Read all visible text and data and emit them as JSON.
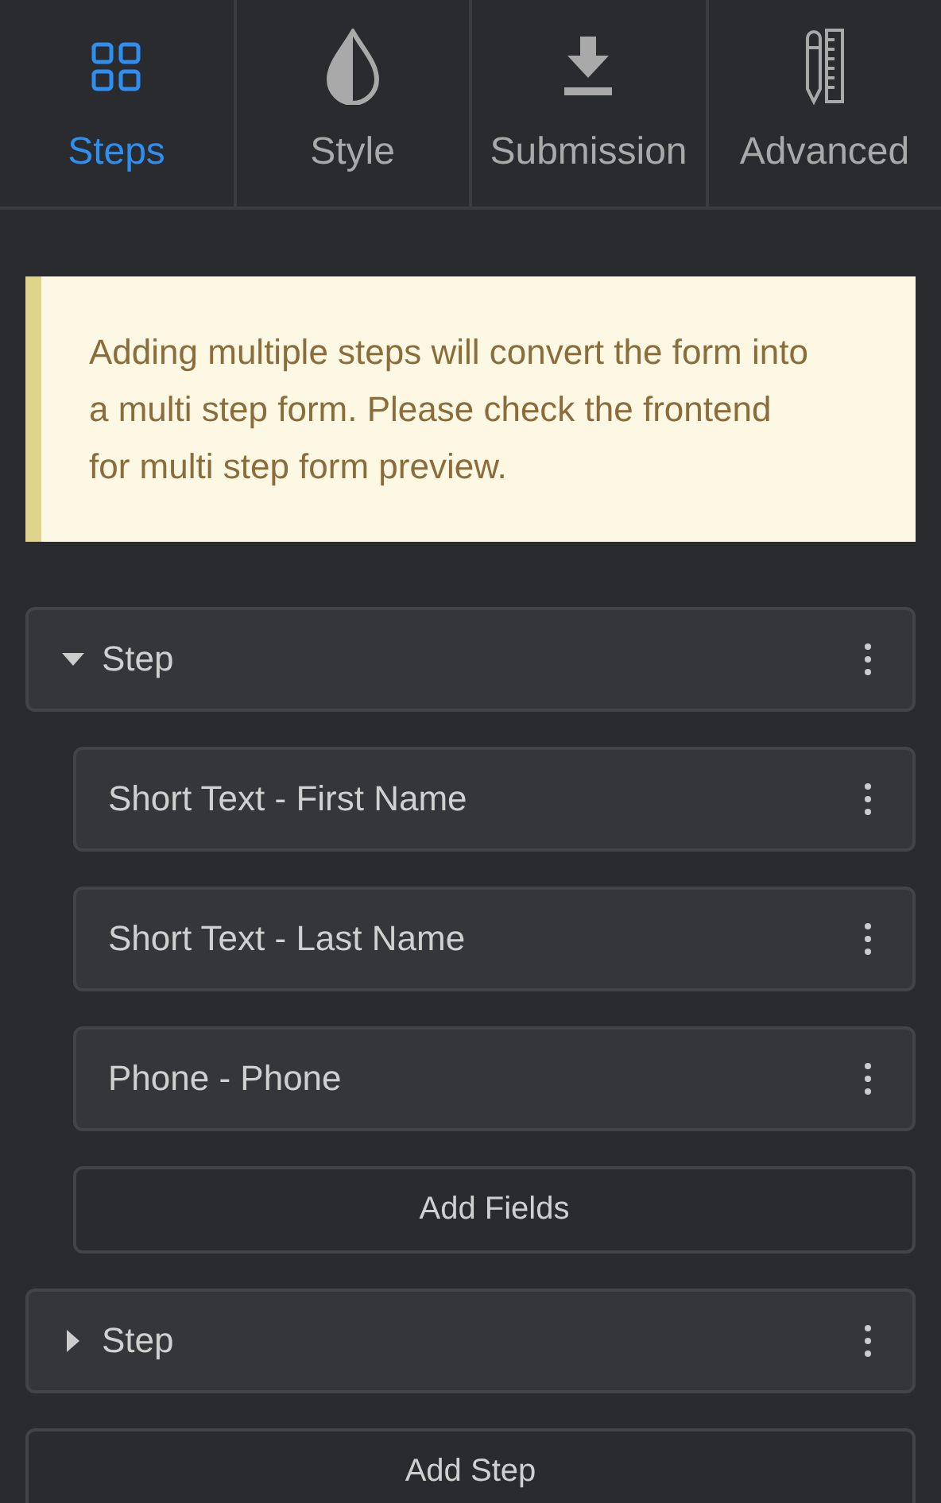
{
  "tabs": [
    {
      "label": "Steps",
      "kind": "grid",
      "selected": true
    },
    {
      "label": "Style",
      "kind": "drop",
      "selected": false
    },
    {
      "label": "Submission",
      "kind": "download",
      "selected": false
    },
    {
      "label": "Advanced",
      "kind": "tools",
      "selected": false
    }
  ],
  "notice": {
    "text": "Adding multiple steps will convert the form into a multi step form. Please check the frontend for multi step form preview."
  },
  "steps": [
    {
      "label": "Step",
      "expanded": true,
      "fields": [
        {
          "label": "Short Text - First Name"
        },
        {
          "label": "Short Text - Last Name"
        },
        {
          "label": "Phone - Phone"
        }
      ],
      "add_fields_button": "Add Fields"
    },
    {
      "label": "Step",
      "expanded": false
    }
  ],
  "add_step_button": "Add Step"
}
